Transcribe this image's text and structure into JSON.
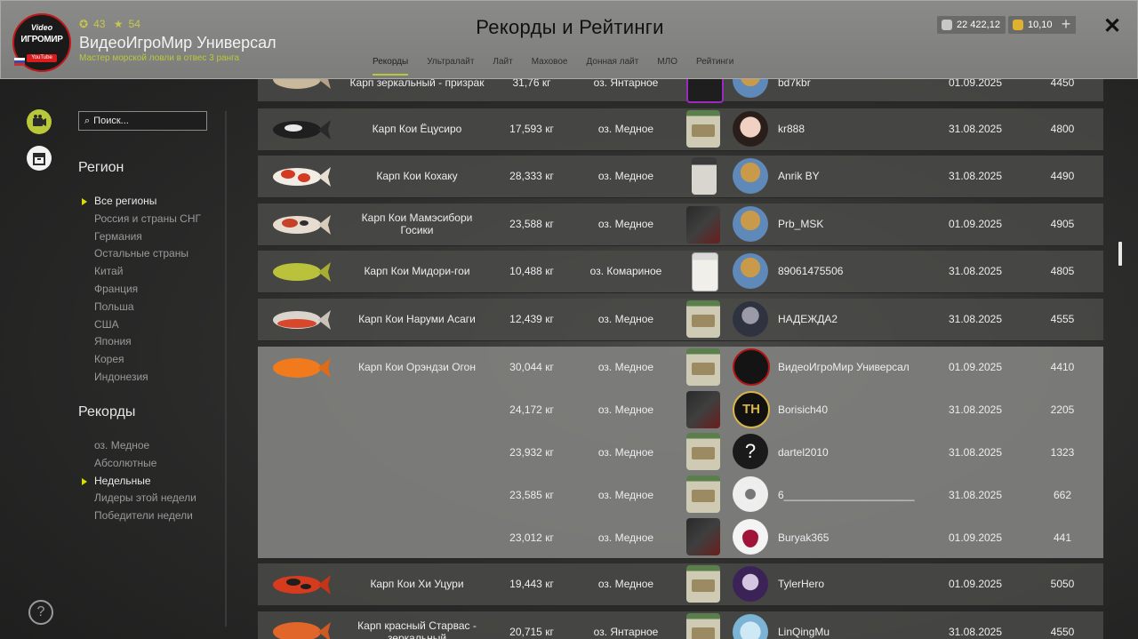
{
  "header": {
    "title": "Рекорды и Рейтинги",
    "profile": {
      "avatar_line1": "Video",
      "avatar_line2": "ИГРОМИР",
      "avatar_line3": "YouTube",
      "level": "43",
      "stars": "54",
      "username": "ВидеоИгроМир Универсал",
      "rank": "Мастер морской ловли в отвес 3 ранга"
    },
    "tabs": [
      "Рекорды",
      "Ультралайт",
      "Лайт",
      "Маховое",
      "Донная лайт",
      "МЛО",
      "Рейтинги"
    ],
    "active_tab": "Рекорды",
    "currency_silver": "22 422,12",
    "currency_gold": "10,10",
    "plus_label": "+",
    "close_label": "✕"
  },
  "sidebar": {
    "search_placeholder": "Поиск...",
    "region_title": "Регион",
    "regions": [
      "Все регионы",
      "Россия и страны СНГ",
      "Германия",
      "Остальные страны",
      "Китай",
      "Франция",
      "Польша",
      "США",
      "Япония",
      "Корея",
      "Индонезия"
    ],
    "records_title": "Рекорды",
    "records": [
      "оз. Медное",
      "Абсолютные",
      "Недельные",
      "Лидеры этой недели",
      "Победители недели"
    ],
    "help_label": "?"
  },
  "rows": [
    {
      "fish": "Карп зеркальный - призрак",
      "weight": "31,76 кг",
      "lake": "оз. Янтарное",
      "player": "bd7kbr",
      "date": "01.09.2025",
      "score": "4450"
    },
    {
      "fish": "Карп Кои Ёцусиро",
      "weight": "17,593 кг",
      "lake": "оз. Медное",
      "player": "kr888",
      "date": "31.08.2025",
      "score": "4800"
    },
    {
      "fish": "Карп Кои Кохаку",
      "weight": "28,333 кг",
      "lake": "оз. Медное",
      "player": "Anrik BY",
      "date": "31.08.2025",
      "score": "4490"
    },
    {
      "fish": "Карп Кои Мамэсибори Госики",
      "weight": "23,588 кг",
      "lake": "оз. Медное",
      "player": "Prb_MSK",
      "date": "01.09.2025",
      "score": "4905"
    },
    {
      "fish": "Карп Кои Мидори-гои",
      "weight": "10,488 кг",
      "lake": "оз. Комариное",
      "player": "89061475506",
      "date": "31.08.2025",
      "score": "4805"
    },
    {
      "fish": "Карп Кои Наруми Асаги",
      "weight": "12,439 кг",
      "lake": "оз. Медное",
      "player": "НАДЕЖДА2",
      "date": "31.08.2025",
      "score": "4555"
    },
    {
      "fish": "Карп Кои Орэндзи Огон",
      "weight": "30,044 кг",
      "lake": "оз. Медное",
      "player": "ВидеоИгроМир Универсал",
      "date": "01.09.2025",
      "score": "4410"
    },
    {
      "fish": "",
      "weight": "24,172 кг",
      "lake": "оз. Медное",
      "player": "Borisich40",
      "date": "31.08.2025",
      "score": "2205"
    },
    {
      "fish": "",
      "weight": "23,932 кг",
      "lake": "оз. Медное",
      "player": "dartel2010",
      "date": "31.08.2025",
      "score": "1323"
    },
    {
      "fish": "",
      "weight": "23,585 кг",
      "lake": "оз. Медное",
      "player": "6______________________",
      "date": "31.08.2025",
      "score": "662"
    },
    {
      "fish": "",
      "weight": "23,012 кг",
      "lake": "оз. Медное",
      "player": "Buryak365",
      "date": "01.09.2025",
      "score": "441"
    },
    {
      "fish": "Карп Кои Хи Уцури",
      "weight": "19,443 кг",
      "lake": "оз. Медное",
      "player": "TylerHero",
      "date": "01.09.2025",
      "score": "5050"
    },
    {
      "fish": "Карп красный Старвас - зеркальный",
      "weight": "20,715 кг",
      "lake": "оз. Янтарное",
      "player": "LinQingMu",
      "date": "31.08.2025",
      "score": "4550"
    }
  ],
  "colors": {
    "accent": "#b9c83a",
    "highlight_row": "#80807e",
    "row": "#4a4a48"
  }
}
